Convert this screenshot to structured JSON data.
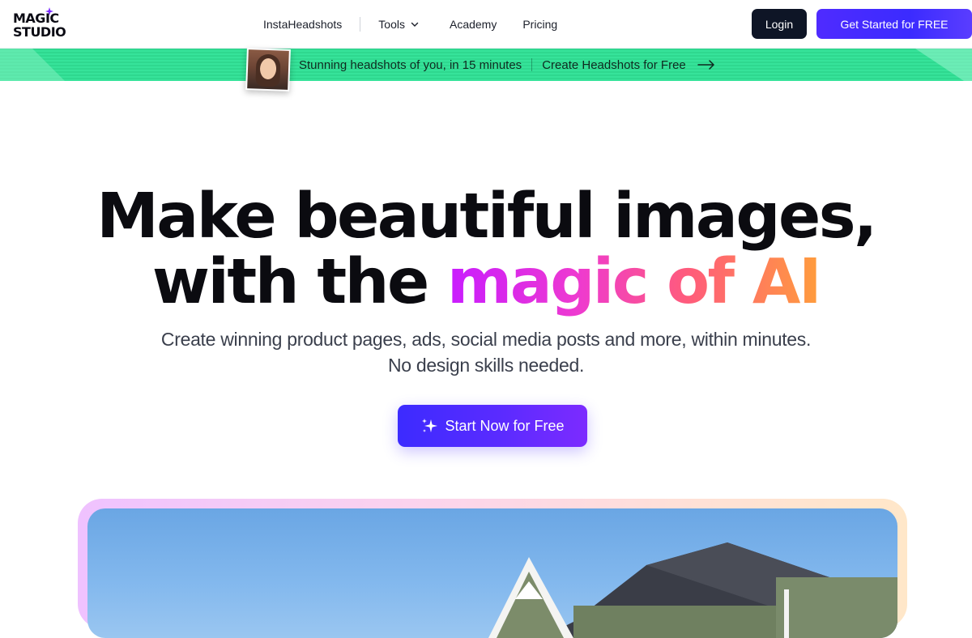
{
  "nav": {
    "logo_line1": "MAGIC",
    "logo_line2": "STUDIO",
    "links": [
      "InstaHeadshots",
      "Tools",
      "Academy",
      "Pricing"
    ],
    "login_label": "Login",
    "get_started_label": "Get Started for FREE"
  },
  "banner": {
    "text": "Stunning headshots of you, in 15 minutes",
    "cta_label": "Create Headshots for Free"
  },
  "hero": {
    "title_line1": "Make beautiful images,",
    "title_line2_plain": "with the ",
    "title_line2_gradient": "magic of AI",
    "subtitle_line1": "Create winning product pages, ads, social media posts and more, within minutes.",
    "subtitle_line2": "No design skills needed.",
    "cta_label": "Start Now for Free"
  },
  "colors": {
    "primary": "#4f2bff",
    "dark_button": "#0e1526",
    "banner_green": "#36e39a",
    "gradient_start": "#c81cff",
    "gradient_end": "#ff9d3d"
  },
  "icons": [
    "magic-star-icon",
    "chevron-down-icon",
    "arrow-right-icon",
    "sparkle-icon"
  ]
}
